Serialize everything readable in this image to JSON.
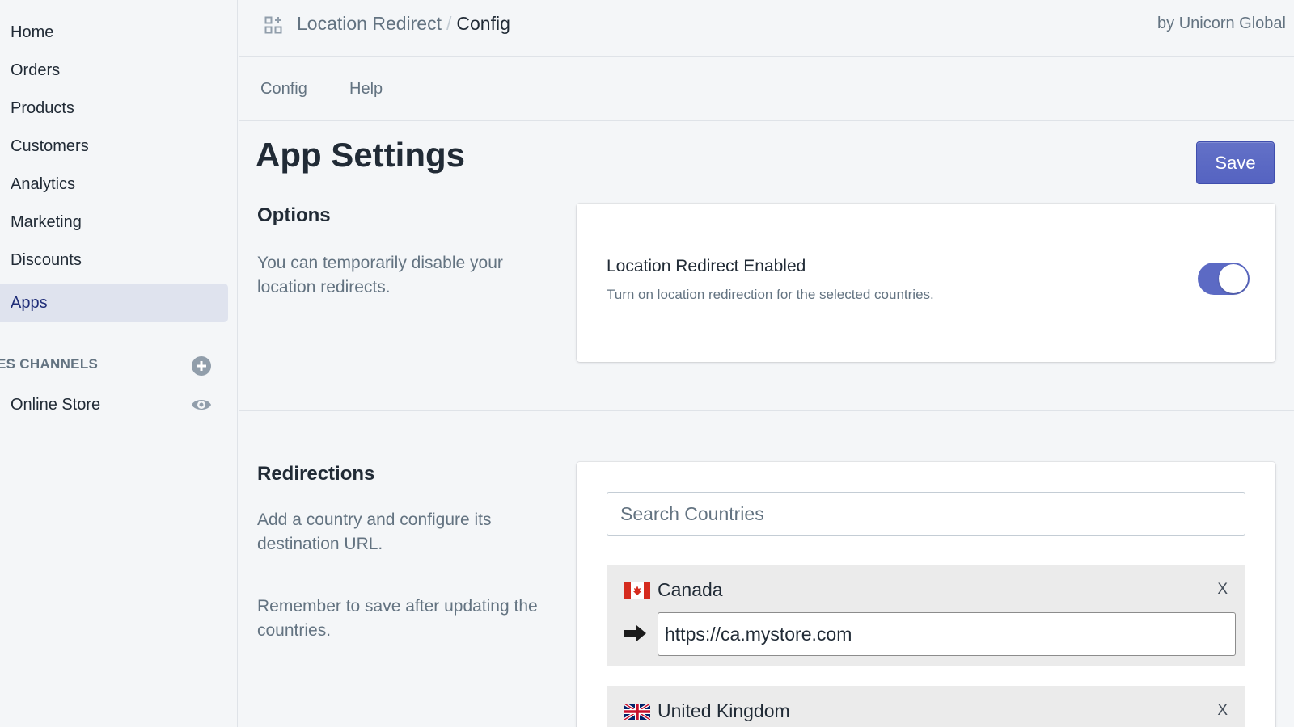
{
  "sidebar": {
    "items": [
      {
        "label": "Home",
        "active": false
      },
      {
        "label": "Orders",
        "active": false
      },
      {
        "label": "Products",
        "active": false
      },
      {
        "label": "Customers",
        "active": false
      },
      {
        "label": "Analytics",
        "active": false
      },
      {
        "label": "Marketing",
        "active": false
      },
      {
        "label": "Discounts",
        "active": false
      },
      {
        "label": "Apps",
        "active": true
      }
    ],
    "channels_heading": "ES CHANNELS",
    "channels": [
      {
        "label": "Online Store"
      }
    ]
  },
  "header": {
    "app_name": "Location Redirect",
    "separator": "/",
    "current_page": "Config",
    "byline": "by Unicorn Global"
  },
  "tabs": [
    {
      "label": "Config"
    },
    {
      "label": "Help"
    }
  ],
  "page": {
    "title": "App Settings",
    "save_label": "Save"
  },
  "options": {
    "title": "Options",
    "description": "You can temporarily disable your location redirects.",
    "setting_label": "Location Redirect Enabled",
    "setting_help": "Turn on location redirection for the selected countries.",
    "enabled": true
  },
  "redirections": {
    "title": "Redirections",
    "description": "Add a country and configure its destination URL.",
    "reminder": "Remember to save after updating the countries.",
    "search_placeholder": "Search Countries",
    "countries": [
      {
        "name": "Canada",
        "flag": "canada-flag-icon",
        "url": "https://ca.mystore.com",
        "remove": "X"
      },
      {
        "name": "United Kingdom",
        "flag": "uk-flag-icon",
        "url": "",
        "remove": "X"
      }
    ]
  },
  "colors": {
    "accent": "#5c6ac4",
    "active_nav_bg": "#dfe3ee",
    "active_nav_text": "#202e78",
    "page_bg": "#f4f6f8"
  }
}
